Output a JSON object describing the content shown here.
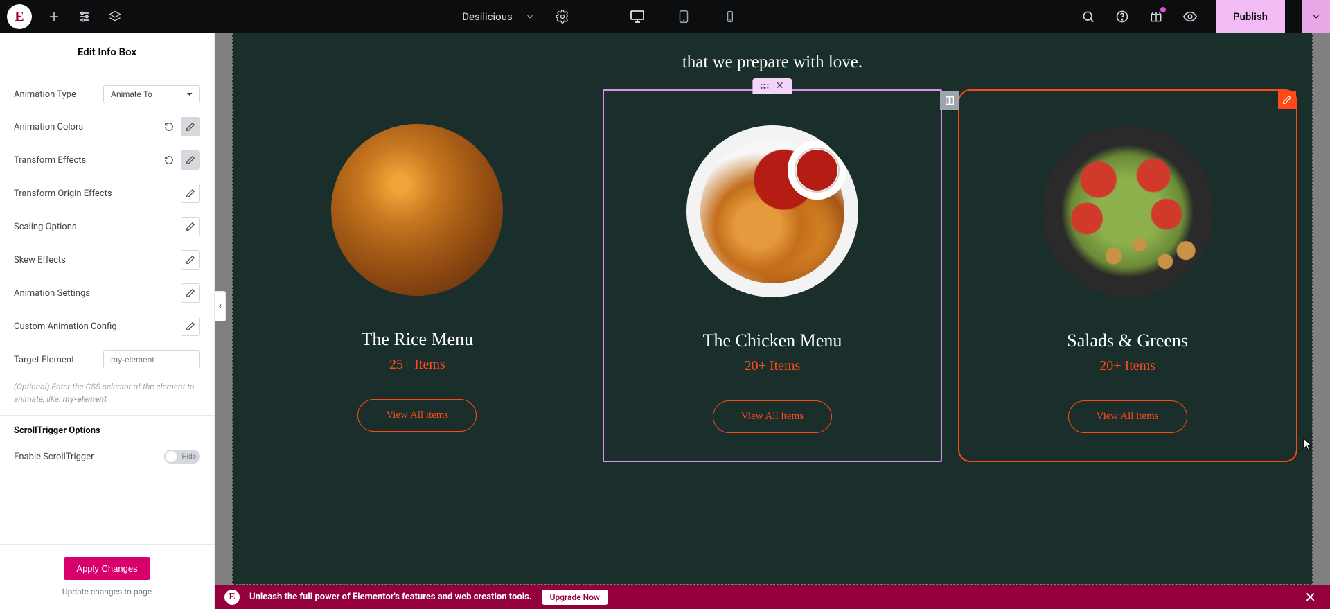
{
  "topbar": {
    "site_name": "Desilicious",
    "publish_label": "Publish"
  },
  "panel": {
    "title": "Edit Info Box",
    "controls": {
      "animation_type_label": "Animation Type",
      "animation_type_value": "Animate To",
      "animation_colors_label": "Animation Colors",
      "transform_effects_label": "Transform Effects",
      "transform_origin_label": "Transform Origin Effects",
      "scaling_label": "Scaling Options",
      "skew_label": "Skew Effects",
      "animation_settings_label": "Animation Settings",
      "custom_anim_label": "Custom Animation Config",
      "target_element_label": "Target Element",
      "target_element_placeholder": "my-element",
      "target_help_prefix": "(Optional) Enter the CSS selector of the element to animate, like: ",
      "target_help_bold": "my-element",
      "scrolltrigger_section": "ScrollTrigger Options",
      "enable_scrolltrigger_label": "Enable ScrollTrigger",
      "toggle_hide": "Hide"
    },
    "footer": {
      "apply_label": "Apply Changes",
      "note": "Update changes to page"
    }
  },
  "canvas": {
    "subtitle": "that we prepare with love.",
    "cards": [
      {
        "title": "The Rice Menu",
        "count": "25+ Items",
        "cta": "View All items"
      },
      {
        "title": "The Chicken Menu",
        "count": "20+ Items",
        "cta": "View All items"
      },
      {
        "title": "Salads & Greens",
        "count": "20+ Items",
        "cta": "View All items"
      }
    ]
  },
  "banner": {
    "message": "Unleash the full power of Elementor's features and web creation tools.",
    "upgrade": "Upgrade Now"
  }
}
